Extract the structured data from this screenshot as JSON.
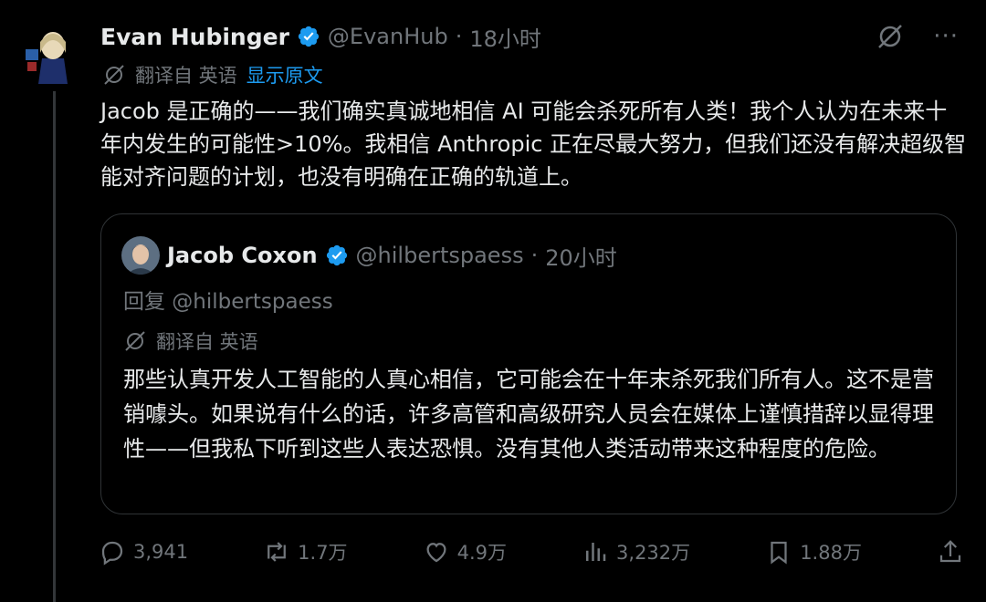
{
  "tweet": {
    "author_name": "Evan Hubinger",
    "handle": "@EvanHub",
    "separator": "·",
    "time": "18小时",
    "translate_label": "翻译自 英语",
    "show_original": "显示原文",
    "body": "Jacob 是正确的——我们确实真诚地相信 AI 可能会杀死所有人类！我个人认为在未来十年内发生的可能性>10%。我相信 Anthropic 正在尽最大努力，但我们还没有解决超级智能对齐问题的计划，也没有明确在正确的轨道上。"
  },
  "quote": {
    "author_name": "Jacob Coxon",
    "handle": "@hilbertspaess",
    "separator": "·",
    "time": "20小时",
    "reply_to": "回复 @hilbertspaess",
    "translate_label": "翻译自 英语",
    "body": "那些认真开发人工智能的人真心相信，它可能会在十年末杀死我们所有人。这不是营销噱头。如果说有什么的话，许多高管和高级研究人员会在媒体上谨慎措辞以显得理性——但我私下听到这些人表达恐惧。没有其他人类活动带来这种程度的危险。"
  },
  "stats": {
    "replies": "3,941",
    "reposts": "1.7万",
    "likes": "4.9万",
    "views": "3,232万",
    "bookmarks": "1.88万"
  },
  "icons": {
    "verified": "verified-badge-icon",
    "grok": "grok-icon",
    "more": "more-icon",
    "translate": "translate-icon",
    "reply": "reply-icon",
    "repost": "repost-icon",
    "like": "like-icon",
    "views": "views-icon",
    "bookmark": "bookmark-icon",
    "share": "share-icon"
  },
  "colors": {
    "background": "#000000",
    "text": "#e7e9ea",
    "secondary": "#71767b",
    "accent": "#1d9bf0",
    "border": "#2f3336"
  }
}
